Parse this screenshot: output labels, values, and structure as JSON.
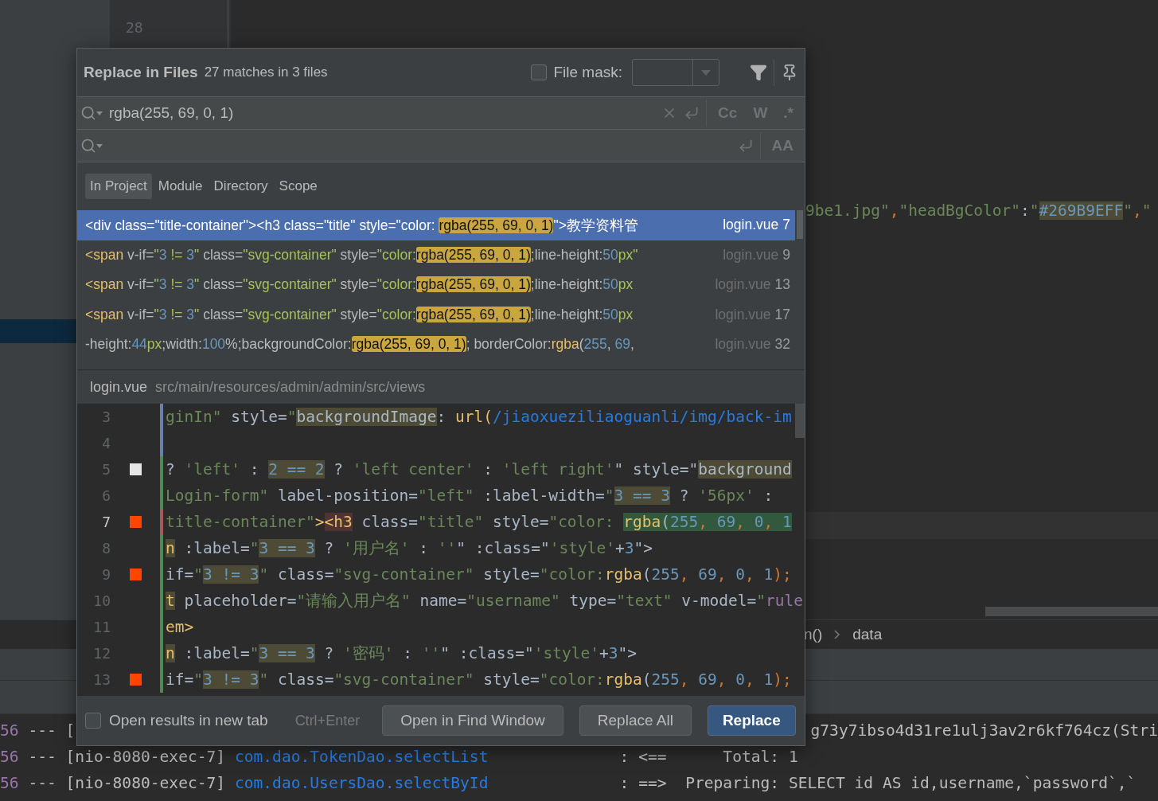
{
  "background": {
    "gutter_lines": [
      "28"
    ],
    "editor_line": [
      {
        "text": "9be1.jpg\"",
        "kind": "string"
      },
      {
        "text": ",",
        "kind": "punct"
      },
      {
        "text": "\"headBgColor\"",
        "kind": "string"
      },
      {
        "text": ":",
        "kind": "text"
      },
      {
        "text": "\"",
        "kind": "string"
      },
      {
        "text": "#269B9EFF",
        "kind": "number",
        "usage": true
      },
      {
        "text": "\"",
        "kind": "string"
      },
      {
        "text": ",",
        "kind": "punct"
      },
      {
        "text": "\"",
        "kind": "string"
      }
    ],
    "breadcrumb": [
      "n()",
      "data"
    ],
    "console": [
      {
        "parts": [
          [
            {
              "text": "56",
              "kind": "num"
            },
            {
              "text": " --- [",
              "kind": "plain"
            }
          ],
          [
            {
              "text": "g73y7ibso4d31re1ulj3av2r6kf764cz(Stri",
              "kind": "plain"
            }
          ]
        ]
      },
      {
        "parts": [
          [
            {
              "text": "56",
              "kind": "num"
            },
            {
              "text": " --- [nio-8080-exec-7] ",
              "kind": "plain"
            },
            {
              "text": "com.dao.TokenDao.selectList",
              "kind": "link"
            },
            {
              "text": "              : <==      Total: 1",
              "kind": "plain"
            }
          ]
        ]
      },
      {
        "parts": [
          [
            {
              "text": "56",
              "kind": "num"
            },
            {
              "text": " --- [nio-8080-exec-7] ",
              "kind": "plain"
            },
            {
              "text": "com.dao.UsersDao.selectById",
              "kind": "link"
            },
            {
              "text": "              : ==>  Preparing: SELECT id AS id,username,`password`,`",
              "kind": "plain"
            }
          ]
        ]
      }
    ]
  },
  "dialog": {
    "title": "Replace in Files",
    "summary": "27 matches in 3 files",
    "file_mask": {
      "label": "File mask:",
      "checked": false
    },
    "search": {
      "value": "rgba(255, 69, 0, 1)",
      "toggles": [
        {
          "label": "Cc",
          "selected": false
        },
        {
          "label": "W",
          "selected": false
        },
        {
          "label": ".*",
          "selected": false
        }
      ]
    },
    "replace": {
      "toggles": [
        {
          "label": "AA",
          "selected": false
        }
      ]
    },
    "scopes": [
      {
        "label": "In Project",
        "selected": true
      },
      {
        "label": "Module",
        "selected": false
      },
      {
        "label": "Directory",
        "selected": false
      },
      {
        "label": "Scope",
        "selected": false
      }
    ],
    "results": [
      {
        "selected": true,
        "file": "login.vue",
        "line": "7",
        "segments": [
          {
            "text": "<div class=\"title-container\"><h3 class=\"title\" style=\"color: ",
            "kind": "plain"
          },
          {
            "text": "rgba(255, 69, 0, 1)",
            "kind": "match"
          },
          {
            "text": "\">教学资料管",
            "kind": "plain"
          }
        ]
      },
      {
        "selected": false,
        "file": "login.vue",
        "line": "9",
        "segments": [
          {
            "text": "<span",
            "kind": "tag"
          },
          {
            "text": " v-if=",
            "kind": "attr"
          },
          {
            "text": "\"",
            "kind": "string"
          },
          {
            "text": "3",
            "kind": "number"
          },
          {
            "text": " != ",
            "kind": "string"
          },
          {
            "text": "3",
            "kind": "number"
          },
          {
            "text": "\"",
            "kind": "string"
          },
          {
            "text": " class=",
            "kind": "attr"
          },
          {
            "text": "\"svg-container\"",
            "kind": "string"
          },
          {
            "text": " style=",
            "kind": "attr"
          },
          {
            "text": "\"color:",
            "kind": "string"
          },
          {
            "text": "rgba(255, 69, 0, 1)",
            "kind": "match"
          },
          {
            "text": ";line-height:",
            "kind": "attr"
          },
          {
            "text": "50",
            "kind": "number"
          },
          {
            "text": "px\"",
            "kind": "string"
          }
        ]
      },
      {
        "selected": false,
        "file": "login.vue",
        "line": "13",
        "segments": [
          {
            "text": "<span",
            "kind": "tag"
          },
          {
            "text": " v-if=",
            "kind": "attr"
          },
          {
            "text": "\"",
            "kind": "string"
          },
          {
            "text": "3",
            "kind": "number"
          },
          {
            "text": " != ",
            "kind": "string"
          },
          {
            "text": "3",
            "kind": "number"
          },
          {
            "text": "\"",
            "kind": "string"
          },
          {
            "text": " class=",
            "kind": "attr"
          },
          {
            "text": "\"svg-container\"",
            "kind": "string"
          },
          {
            "text": " style=",
            "kind": "attr"
          },
          {
            "text": "\"color:",
            "kind": "string"
          },
          {
            "text": "rgba(255, 69, 0, 1)",
            "kind": "match"
          },
          {
            "text": ";line-height:",
            "kind": "attr"
          },
          {
            "text": "50",
            "kind": "number"
          },
          {
            "text": "px",
            "kind": "string"
          }
        ]
      },
      {
        "selected": false,
        "file": "login.vue",
        "line": "17",
        "segments": [
          {
            "text": "<span",
            "kind": "tag"
          },
          {
            "text": " v-if=",
            "kind": "attr"
          },
          {
            "text": "\"",
            "kind": "string"
          },
          {
            "text": "3",
            "kind": "number"
          },
          {
            "text": " != ",
            "kind": "string"
          },
          {
            "text": "3",
            "kind": "number"
          },
          {
            "text": "\"",
            "kind": "string"
          },
          {
            "text": " class=",
            "kind": "attr"
          },
          {
            "text": "\"svg-container\"",
            "kind": "string"
          },
          {
            "text": " style=",
            "kind": "attr"
          },
          {
            "text": "\"color:",
            "kind": "string"
          },
          {
            "text": "rgba(255, 69, 0, 1)",
            "kind": "match"
          },
          {
            "text": ";line-height:",
            "kind": "attr"
          },
          {
            "text": "50",
            "kind": "number"
          },
          {
            "text": "px",
            "kind": "string"
          }
        ]
      },
      {
        "selected": false,
        "file": "login.vue",
        "line": "32",
        "segments": [
          {
            "text": "-height:",
            "kind": "attr"
          },
          {
            "text": "44",
            "kind": "number"
          },
          {
            "text": "px",
            "kind": "string"
          },
          {
            "text": ";width:",
            "kind": "attr"
          },
          {
            "text": "100",
            "kind": "number"
          },
          {
            "text": "%;backgroundColor:",
            "kind": "attr"
          },
          {
            "text": "rgba(255, 69, 0, 1)",
            "kind": "match"
          },
          {
            "text": "; borderColor:",
            "kind": "attr"
          },
          {
            "text": "rgba",
            "kind": "tag"
          },
          {
            "text": "(",
            "kind": "attr"
          },
          {
            "text": "255",
            "kind": "number"
          },
          {
            "text": ", ",
            "kind": "attr"
          },
          {
            "text": "69",
            "kind": "number"
          },
          {
            "text": ", ",
            "kind": "attr"
          }
        ]
      }
    ],
    "preview": {
      "file": "login.vue",
      "path": "src/main/resources/admin/admin/src/views",
      "lines": [
        {
          "number": "3",
          "current": false,
          "kind": "modified",
          "segments": [
            {
              "text": "ginIn\"",
              "kind": "string"
            },
            {
              "text": " style=",
              "kind": "text"
            },
            {
              "text": "\"",
              "kind": "string"
            },
            {
              "text": "backgroundImage",
              "kind": "text",
              "usage": true
            },
            {
              "text": ": ",
              "kind": "text"
            },
            {
              "text": "url(",
              "kind": "tag"
            },
            {
              "text": "/jiaoxueziliaoguanli/img/back-im",
              "kind": "url"
            }
          ]
        },
        {
          "number": "4",
          "current": false,
          "kind": "modified"
        },
        {
          "number": "5",
          "current": false,
          "kind": "added",
          "color": "#e6e6e6",
          "segments": [
            {
              "text": "? ",
              "kind": "text"
            },
            {
              "text": "'left'",
              "kind": "string"
            },
            {
              "text": " : ",
              "kind": "text"
            },
            {
              "text": "2 == 2",
              "kind": "number",
              "usage": true
            },
            {
              "text": " ? ",
              "kind": "text"
            },
            {
              "text": "'left center'",
              "kind": "string"
            },
            {
              "text": " : ",
              "kind": "text"
            },
            {
              "text": "'left right'",
              "kind": "string"
            },
            {
              "text": "\" style=\"",
              "kind": "text"
            },
            {
              "text": "background",
              "kind": "text",
              "usage": true
            }
          ]
        },
        {
          "number": "6",
          "current": false,
          "kind": "added",
          "segments": [
            {
              "text": "Login-form\"",
              "kind": "string"
            },
            {
              "text": " label-position=",
              "kind": "text"
            },
            {
              "text": "\"left\"",
              "kind": "string"
            },
            {
              "text": " :label-width=",
              "kind": "text"
            },
            {
              "text": "\"",
              "kind": "string"
            },
            {
              "text": "3 == 3",
              "kind": "number",
              "usage": true
            },
            {
              "text": " ? ",
              "kind": "text"
            },
            {
              "text": "'56px'",
              "kind": "string"
            },
            {
              "text": " : ",
              "kind": "text"
            }
          ]
        },
        {
          "number": "7",
          "current": true,
          "kind": "conflict",
          "color": "#ff4500",
          "segments": [
            {
              "text": "title-container\"",
              "kind": "string"
            },
            {
              "text": ">",
              "kind": "tag"
            },
            {
              "text": "<h3",
              "kind": "tag",
              "paired": true
            },
            {
              "text": " class=",
              "kind": "text"
            },
            {
              "text": "\"title\"",
              "kind": "string"
            },
            {
              "text": " style=",
              "kind": "text"
            },
            {
              "text": "\"color: ",
              "kind": "string"
            },
            {
              "text": "rgba",
              "kind": "tag",
              "found": true
            },
            {
              "text": "(",
              "kind": "text",
              "found": true
            },
            {
              "text": "255",
              "kind": "number",
              "found": true
            },
            {
              "text": ", ",
              "kind": "punct",
              "found": true
            },
            {
              "text": "69",
              "kind": "number",
              "found": true
            },
            {
              "text": ", ",
              "kind": "punct",
              "found": true
            },
            {
              "text": "0",
              "kind": "number",
              "found": true
            },
            {
              "text": ", ",
              "kind": "punct",
              "found": true
            },
            {
              "text": "1",
              "kind": "number",
              "found": true
            }
          ]
        },
        {
          "number": "8",
          "current": false,
          "kind": "added",
          "segments": [
            {
              "text": "n",
              "kind": "tag",
              "usage": true
            },
            {
              "text": " :label=",
              "kind": "text"
            },
            {
              "text": "\"",
              "kind": "string"
            },
            {
              "text": "3 == 3",
              "kind": "number",
              "usage": true
            },
            {
              "text": " ? ",
              "kind": "text"
            },
            {
              "text": "'用户名'",
              "kind": "string"
            },
            {
              "text": " : ",
              "kind": "text"
            },
            {
              "text": "''",
              "kind": "string"
            },
            {
              "text": "\" :class=\"",
              "kind": "text"
            },
            {
              "text": "'style'",
              "kind": "string"
            },
            {
              "text": "+",
              "kind": "text"
            },
            {
              "text": "3",
              "kind": "number"
            },
            {
              "text": "\">",
              "kind": "text"
            }
          ]
        },
        {
          "number": "9",
          "current": false,
          "kind": "added",
          "color": "#ff4500",
          "segments": [
            {
              "text": "if=",
              "kind": "text"
            },
            {
              "text": "\"",
              "kind": "string"
            },
            {
              "text": "3 != 3",
              "kind": "number",
              "usage": true
            },
            {
              "text": "\"",
              "kind": "string"
            },
            {
              "text": " class=",
              "kind": "text"
            },
            {
              "text": "\"svg-container\"",
              "kind": "string"
            },
            {
              "text": " style=",
              "kind": "text"
            },
            {
              "text": "\"color:",
              "kind": "string"
            },
            {
              "text": "rgba",
              "kind": "tag"
            },
            {
              "text": "(",
              "kind": "text"
            },
            {
              "text": "255",
              "kind": "number"
            },
            {
              "text": ", ",
              "kind": "punct"
            },
            {
              "text": "69",
              "kind": "number"
            },
            {
              "text": ", ",
              "kind": "punct"
            },
            {
              "text": "0",
              "kind": "number"
            },
            {
              "text": ", ",
              "kind": "punct"
            },
            {
              "text": "1",
              "kind": "number"
            },
            {
              "text": ");",
              "kind": "punct"
            }
          ]
        },
        {
          "number": "10",
          "current": false,
          "kind": "added",
          "segments": [
            {
              "text": "t",
              "kind": "tag",
              "usage": true
            },
            {
              "text": " placeholder=",
              "kind": "text"
            },
            {
              "text": "\"请输入用户名\"",
              "kind": "string"
            },
            {
              "text": " name=",
              "kind": "text"
            },
            {
              "text": "\"username\"",
              "kind": "string"
            },
            {
              "text": " type=",
              "kind": "text"
            },
            {
              "text": "\"text\"",
              "kind": "string"
            },
            {
              "text": " v-model=",
              "kind": "text"
            },
            {
              "text": "\"",
              "kind": "string"
            },
            {
              "text": "rule",
              "kind": "value"
            }
          ]
        },
        {
          "number": "11",
          "current": false,
          "kind": "added",
          "segments": [
            {
              "text": "em>",
              "kind": "tag"
            }
          ]
        },
        {
          "number": "12",
          "current": false,
          "kind": "added",
          "segments": [
            {
              "text": "n",
              "kind": "tag",
              "usage": true
            },
            {
              "text": " :label=",
              "kind": "text"
            },
            {
              "text": "\"",
              "kind": "string"
            },
            {
              "text": "3 == 3",
              "kind": "number",
              "usage": true
            },
            {
              "text": " ? ",
              "kind": "text"
            },
            {
              "text": "'密码'",
              "kind": "string"
            },
            {
              "text": " : ",
              "kind": "text"
            },
            {
              "text": "''",
              "kind": "string"
            },
            {
              "text": "\" :class=\"",
              "kind": "text"
            },
            {
              "text": "'style'",
              "kind": "string"
            },
            {
              "text": "+",
              "kind": "text"
            },
            {
              "text": "3",
              "kind": "number"
            },
            {
              "text": "\">",
              "kind": "text"
            }
          ]
        },
        {
          "number": "13",
          "current": false,
          "kind": "added",
          "color": "#ff4500",
          "segments": [
            {
              "text": "if=",
              "kind": "text"
            },
            {
              "text": "\"",
              "kind": "string"
            },
            {
              "text": "3 != 3",
              "kind": "number",
              "usage": true
            },
            {
              "text": "\"",
              "kind": "string"
            },
            {
              "text": " class=",
              "kind": "text"
            },
            {
              "text": "\"svg-container\"",
              "kind": "string"
            },
            {
              "text": " style=",
              "kind": "text"
            },
            {
              "text": "\"color:",
              "kind": "string"
            },
            {
              "text": "rgba",
              "kind": "tag"
            },
            {
              "text": "(",
              "kind": "text"
            },
            {
              "text": "255",
              "kind": "number"
            },
            {
              "text": ", ",
              "kind": "punct"
            },
            {
              "text": "69",
              "kind": "number"
            },
            {
              "text": ", ",
              "kind": "punct"
            },
            {
              "text": "0",
              "kind": "number"
            },
            {
              "text": ", ",
              "kind": "punct"
            },
            {
              "text": "1",
              "kind": "number"
            },
            {
              "text": ");",
              "kind": "punct"
            }
          ]
        }
      ]
    },
    "new_tab": {
      "label": "Open results in new tab",
      "checked": false
    },
    "shortcut": "Ctrl+Enter",
    "buttons": [
      {
        "label": "Open in Find Window",
        "default": false
      },
      {
        "label": "Replace All",
        "default": false
      },
      {
        "label": "Replace",
        "default": true
      }
    ]
  }
}
